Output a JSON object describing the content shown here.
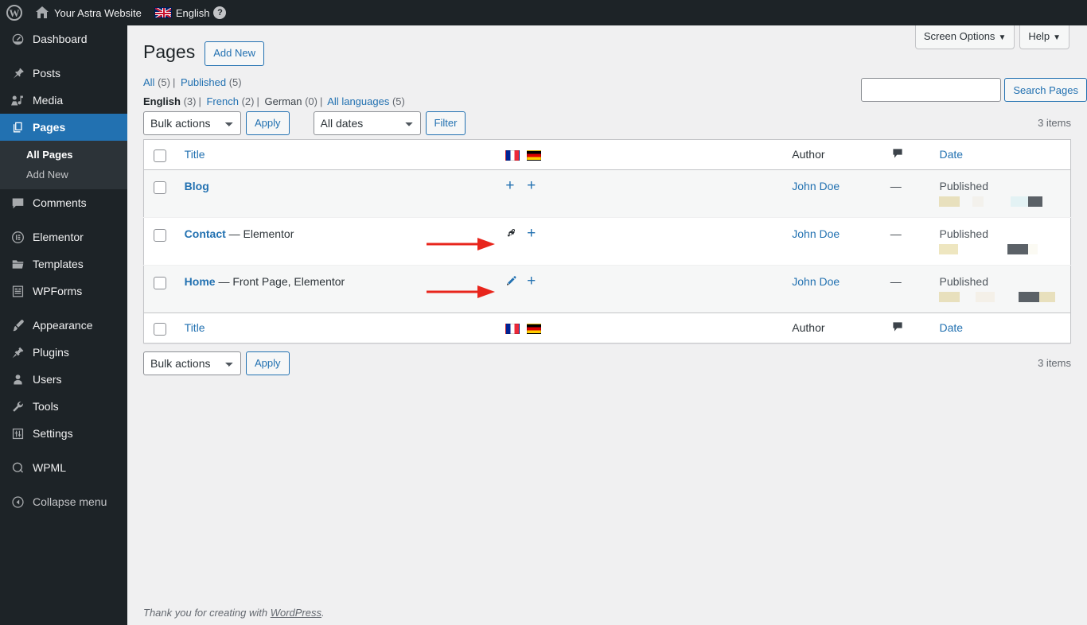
{
  "adminbar": {
    "wp_logo": "W",
    "home_label": "Your Astra Website",
    "language": "English",
    "help": "?"
  },
  "sidebar": {
    "items": [
      {
        "label": "Dashboard",
        "icon": "dashboard-icon",
        "current": false
      },
      {
        "label": "Posts",
        "icon": "pin-icon",
        "current": false
      },
      {
        "label": "Media",
        "icon": "media-icon",
        "current": false
      },
      {
        "label": "Pages",
        "icon": "pages-icon",
        "current": true
      },
      {
        "label": "Comments",
        "icon": "comment-icon",
        "current": false
      },
      {
        "label": "Elementor",
        "icon": "elementor-icon",
        "current": false
      },
      {
        "label": "Templates",
        "icon": "folder-icon",
        "current": false
      },
      {
        "label": "WPForms",
        "icon": "wpforms-icon",
        "current": false
      },
      {
        "label": "Appearance",
        "icon": "brush-icon",
        "current": false
      },
      {
        "label": "Plugins",
        "icon": "plugin-icon",
        "current": false
      },
      {
        "label": "Users",
        "icon": "user-icon",
        "current": false
      },
      {
        "label": "Tools",
        "icon": "wrench-icon",
        "current": false
      },
      {
        "label": "Settings",
        "icon": "settings-icon",
        "current": false
      },
      {
        "label": "WPML",
        "icon": "wpml-icon",
        "current": false
      },
      {
        "label": "Collapse menu",
        "icon": "collapse-icon",
        "current": false
      }
    ],
    "submenu": [
      {
        "label": "All Pages",
        "current": true
      },
      {
        "label": "Add New",
        "current": false
      }
    ]
  },
  "screen_meta": {
    "screen_options": "Screen Options",
    "help": "Help",
    "caret": "▼"
  },
  "header": {
    "title": "Pages",
    "add_new": "Add New"
  },
  "status_filters": [
    {
      "label": "All",
      "count": "(5)",
      "current": false
    },
    {
      "label": "Published",
      "count": "(5)",
      "current": false
    }
  ],
  "language_filters": [
    {
      "label": "English",
      "count": "(3)",
      "current": true
    },
    {
      "label": "French",
      "count": "(2)",
      "current": false
    },
    {
      "label": "German",
      "count": "(0)",
      "current": false
    },
    {
      "label": "All languages",
      "count": "(5)",
      "current": false
    }
  ],
  "search": {
    "value": "",
    "placeholder": "",
    "button": "Search Pages"
  },
  "tablenav": {
    "bulk_actions": "Bulk actions",
    "apply": "Apply",
    "dates": "All dates",
    "filter": "Filter",
    "items_count": "3 items"
  },
  "table": {
    "columns": {
      "title": "Title",
      "author": "Author",
      "comments": "comment-bubble-icon",
      "date": "Date",
      "flag_fr": "french-flag-icon",
      "flag_de": "german-flag-icon"
    },
    "rows": [
      {
        "title": "Blog",
        "state": "",
        "fr_action": "plus",
        "de_action": "plus",
        "author": "John Doe",
        "comments": "—",
        "date_status": "Published",
        "arrow": false
      },
      {
        "title": "Contact",
        "state": " — Elementor",
        "fr_action": "gear",
        "de_action": "plus",
        "author": "John Doe",
        "comments": "—",
        "date_status": "Published",
        "arrow": true
      },
      {
        "title": "Home",
        "state": " — Front Page, Elementor",
        "fr_action": "pencil",
        "de_action": "plus",
        "author": "John Doe",
        "comments": "—",
        "date_status": "Published",
        "arrow": true
      }
    ]
  },
  "tablenav_bottom": {
    "bulk_actions": "Bulk actions",
    "apply": "Apply",
    "items_count": "3 items"
  },
  "footer": {
    "thanks_prefix": "Thank you for creating with ",
    "wordpress": "WordPress",
    "suffix": "."
  },
  "colors": {
    "admin_blue": "#2271b1",
    "sidebar_bg": "#1d2327",
    "submenu_bg": "#2c3338",
    "annotation_red": "#e8251c",
    "link": "#2271b1"
  }
}
